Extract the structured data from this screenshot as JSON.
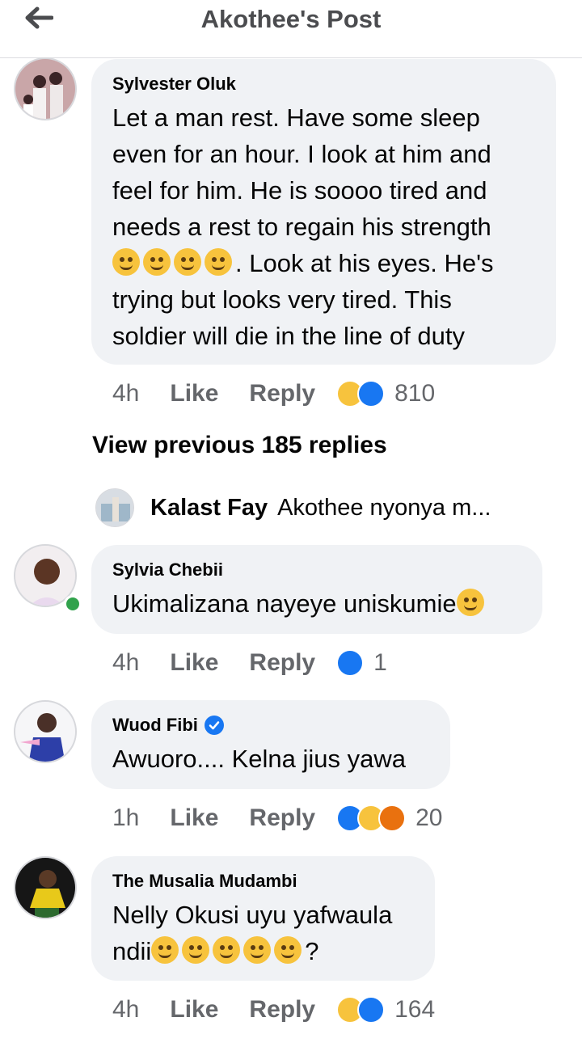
{
  "header": {
    "title": "Akothee's Post",
    "back_icon": "arrow-left-icon"
  },
  "comments": [
    {
      "author": "Sylvester Oluk",
      "lines": [
        "Let a man rest. Have some sleep",
        "even for an hour. I look at him and",
        "feel for him. He is soooo tired and",
        "needs a rest to regain his strength"
      ],
      "line5_text": ". Look at his eyes. He's",
      "line6": "trying but looks very tired. This",
      "line7": "soldier will die in the line of duty",
      "time": "4h",
      "like": "Like",
      "reply": "Reply",
      "reaction_count": "810"
    },
    {
      "author": "Sylvia Chebii",
      "text": "Ukimalizana nayeye uniskumie",
      "time": "4h",
      "like": "Like",
      "reply": "Reply",
      "reaction_count": "1"
    },
    {
      "author": "Wuod Fibi",
      "text": "Awuoro.... Kelna jius yawa",
      "time": "1h",
      "like": "Like",
      "reply": "Reply",
      "reaction_count": "20"
    },
    {
      "author": "The Musalia Mudambi",
      "line1": "Nelly Okusi uyu yafwaula",
      "line2_prefix": "ndii",
      "line2_suffix": "?",
      "time": "4h",
      "like": "Like",
      "reply": "Reply",
      "reaction_count": "164"
    }
  ],
  "view_previous": "View previous 185 replies",
  "preview_reply": {
    "name": "Kalast Fay",
    "text": "Akothee nyonya m..."
  },
  "colors": {
    "like_blue": "#1877f2",
    "bubble_bg": "#f0f2f5",
    "online_green": "#31a24c"
  }
}
